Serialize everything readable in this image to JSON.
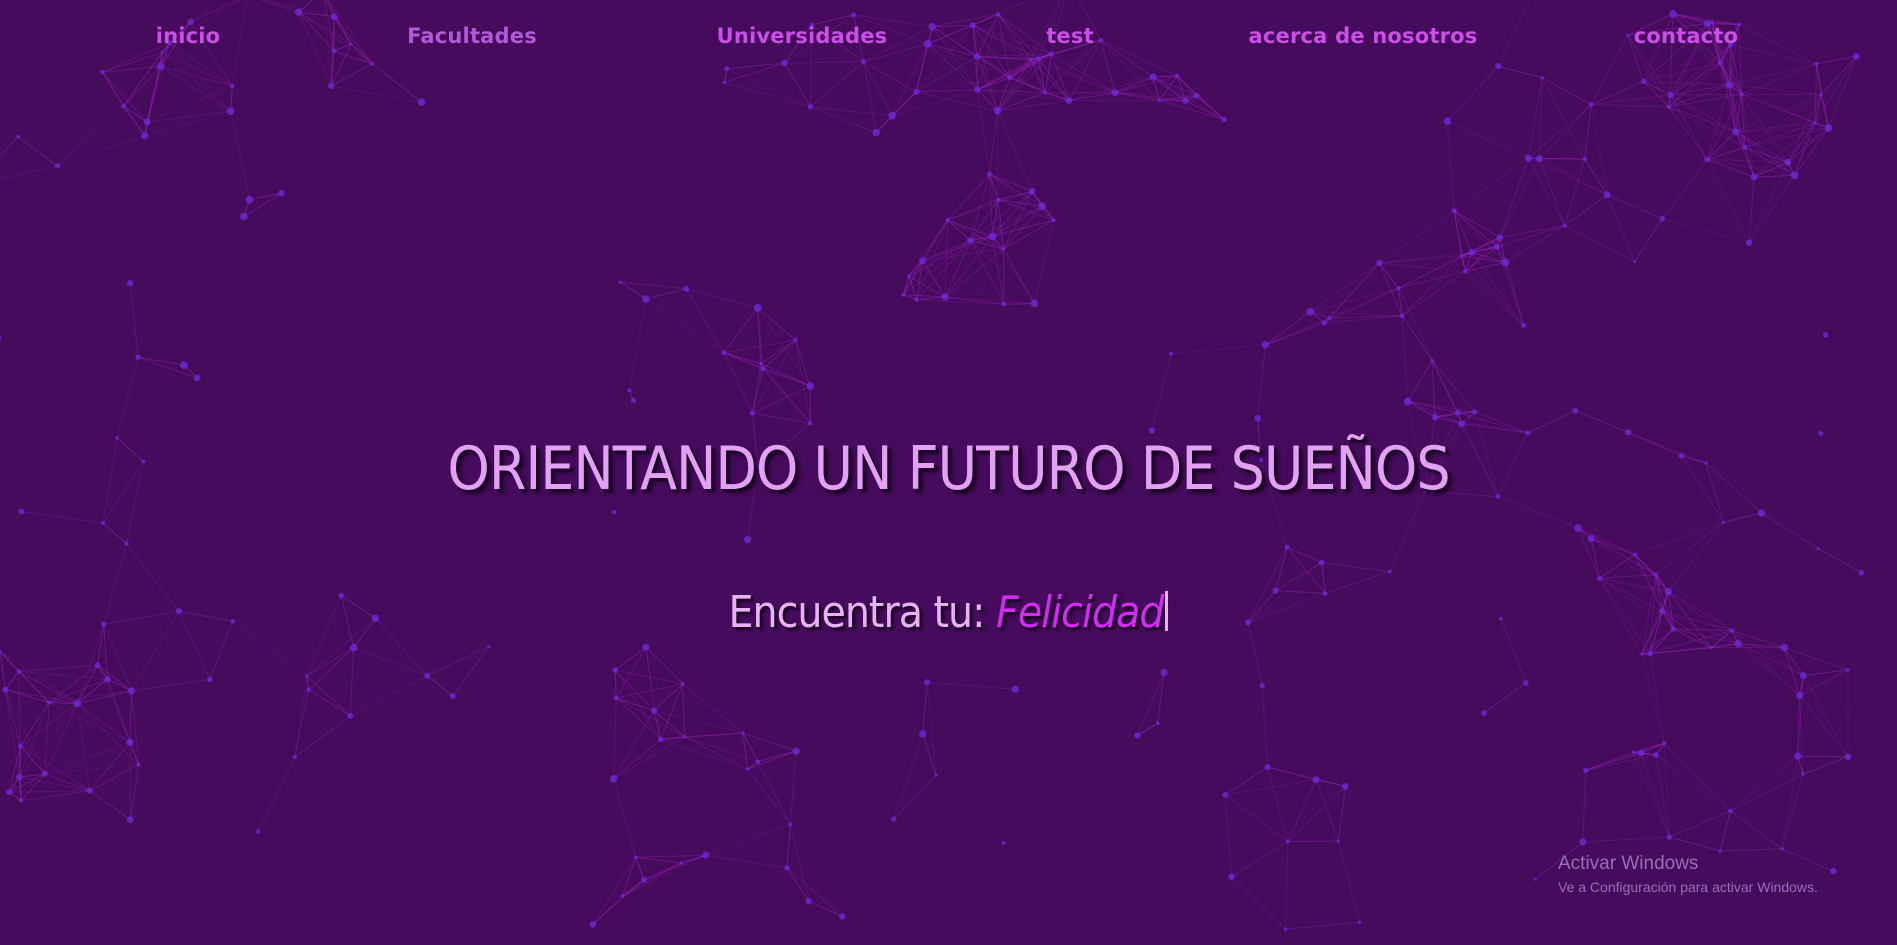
{
  "nav": {
    "items": [
      {
        "label": "inicio"
      },
      {
        "label": "Facultades"
      },
      {
        "label": "Universidades"
      },
      {
        "label": "test"
      },
      {
        "label": "acerca de nosotros"
      },
      {
        "label": "contacto"
      }
    ]
  },
  "hero": {
    "title": "ORIENTANDO UN FUTURO DE SUEÑOS",
    "subtitle_prefix": "Encuentra tu: ",
    "typed_word": "Felicidad"
  },
  "watermark": {
    "title": "Activar Windows",
    "subtitle": "Ve a Configuración para activar Windows."
  },
  "colors": {
    "background": "#470b5e",
    "nav_text": "#c94fe6",
    "title_text": "#e3a1f3",
    "typed_word": "#d22cf2",
    "network_line": "#b12ad0",
    "network_node": "#6a2bd6"
  }
}
